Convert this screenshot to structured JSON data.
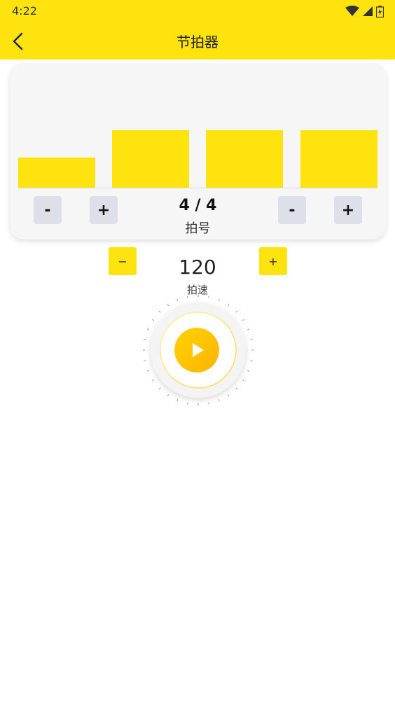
{
  "status": {
    "time": "4:22"
  },
  "header": {
    "title": "节拍器"
  },
  "beats": {
    "levels": [
      0.52,
      1,
      1,
      1
    ],
    "signature": "4 / 4",
    "signature_label": "拍号",
    "buttons": [
      "-",
      "+",
      "-",
      "+"
    ]
  },
  "tempo": {
    "value": "120",
    "label": "拍速",
    "decrease_label": "−",
    "increase_label": "+"
  },
  "colors": {
    "accent": "#FFE30F",
    "play_gradient_start": "#FFD400",
    "play_gradient_end": "#FFB300",
    "button_gray": "#DDE0E8"
  }
}
